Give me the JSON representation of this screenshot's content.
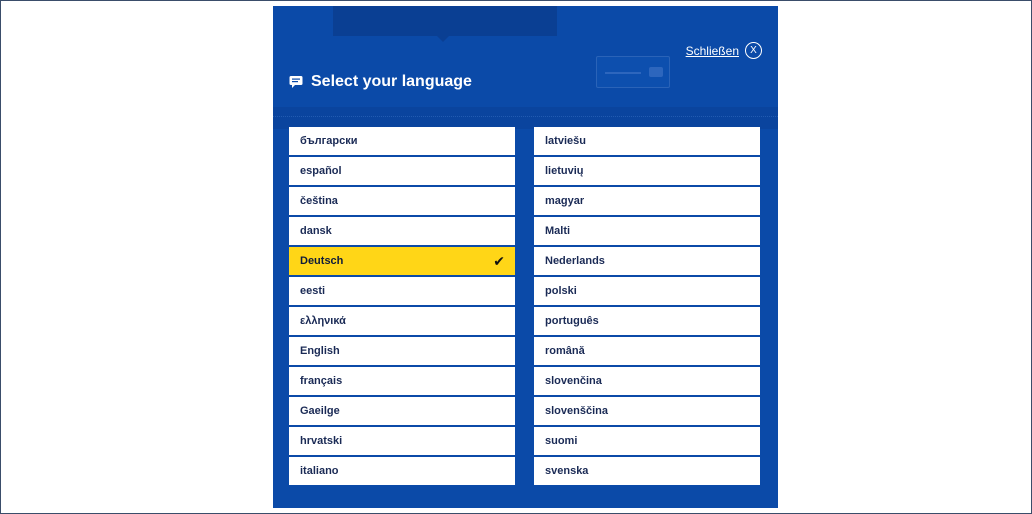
{
  "dialog": {
    "close_label": "Schließen",
    "close_glyph": "X",
    "title": "Select your language",
    "selected_mark": "✔"
  },
  "languages": {
    "left": [
      {
        "label": "български",
        "selected": false
      },
      {
        "label": "español",
        "selected": false
      },
      {
        "label": "čeština",
        "selected": false
      },
      {
        "label": "dansk",
        "selected": false
      },
      {
        "label": "Deutsch",
        "selected": true
      },
      {
        "label": "eesti",
        "selected": false
      },
      {
        "label": "ελληνικά",
        "selected": false
      },
      {
        "label": "English",
        "selected": false
      },
      {
        "label": "français",
        "selected": false
      },
      {
        "label": "Gaeilge",
        "selected": false
      },
      {
        "label": "hrvatski",
        "selected": false
      },
      {
        "label": "italiano",
        "selected": false
      }
    ],
    "right": [
      {
        "label": "latviešu",
        "selected": false
      },
      {
        "label": "lietuvių",
        "selected": false
      },
      {
        "label": "magyar",
        "selected": false
      },
      {
        "label": "Malti",
        "selected": false
      },
      {
        "label": "Nederlands",
        "selected": false
      },
      {
        "label": "polski",
        "selected": false
      },
      {
        "label": "português",
        "selected": false
      },
      {
        "label": "română",
        "selected": false
      },
      {
        "label": "slovenčina",
        "selected": false
      },
      {
        "label": "slovenščina",
        "selected": false
      },
      {
        "label": "suomi",
        "selected": false
      },
      {
        "label": "svenska",
        "selected": false
      }
    ]
  },
  "colors": {
    "overlay": "#0b4aa8",
    "selected": "#ffd617",
    "item_text": "#1a2a55"
  }
}
